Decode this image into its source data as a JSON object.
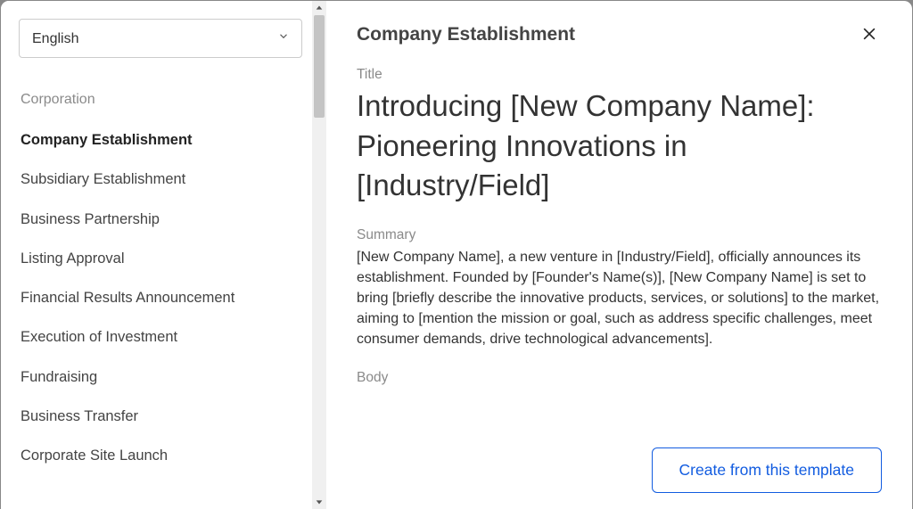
{
  "language": {
    "selected": "English"
  },
  "sidebar": {
    "section_label": "Corporation",
    "items": [
      {
        "label": "Company Establishment",
        "active": true
      },
      {
        "label": "Subsidiary Establishment",
        "active": false
      },
      {
        "label": "Business Partnership",
        "active": false
      },
      {
        "label": "Listing Approval",
        "active": false
      },
      {
        "label": "Financial Results Announcement",
        "active": false
      },
      {
        "label": "Execution of Investment",
        "active": false
      },
      {
        "label": "Fundraising",
        "active": false
      },
      {
        "label": "Business Transfer",
        "active": false
      },
      {
        "label": "Corporate Site Launch",
        "active": false
      }
    ]
  },
  "main": {
    "heading": "Company Establishment",
    "title_label": "Title",
    "title_text": "Introducing [New Company Name]: Pioneering Innovations in [Industry/Field]",
    "summary_label": "Summary",
    "summary_text": "[New Company Name], a new venture in [Industry/Field], officially announces its establishment. Founded by [Founder's Name(s)], [New Company Name] is set to bring [briefly describe the innovative products, services, or solutions] to the market, aiming to [mention the mission or goal, such as address specific challenges, meet consumer demands, drive technological advancements].",
    "body_label": "Body",
    "cta_label": "Create from this template"
  }
}
